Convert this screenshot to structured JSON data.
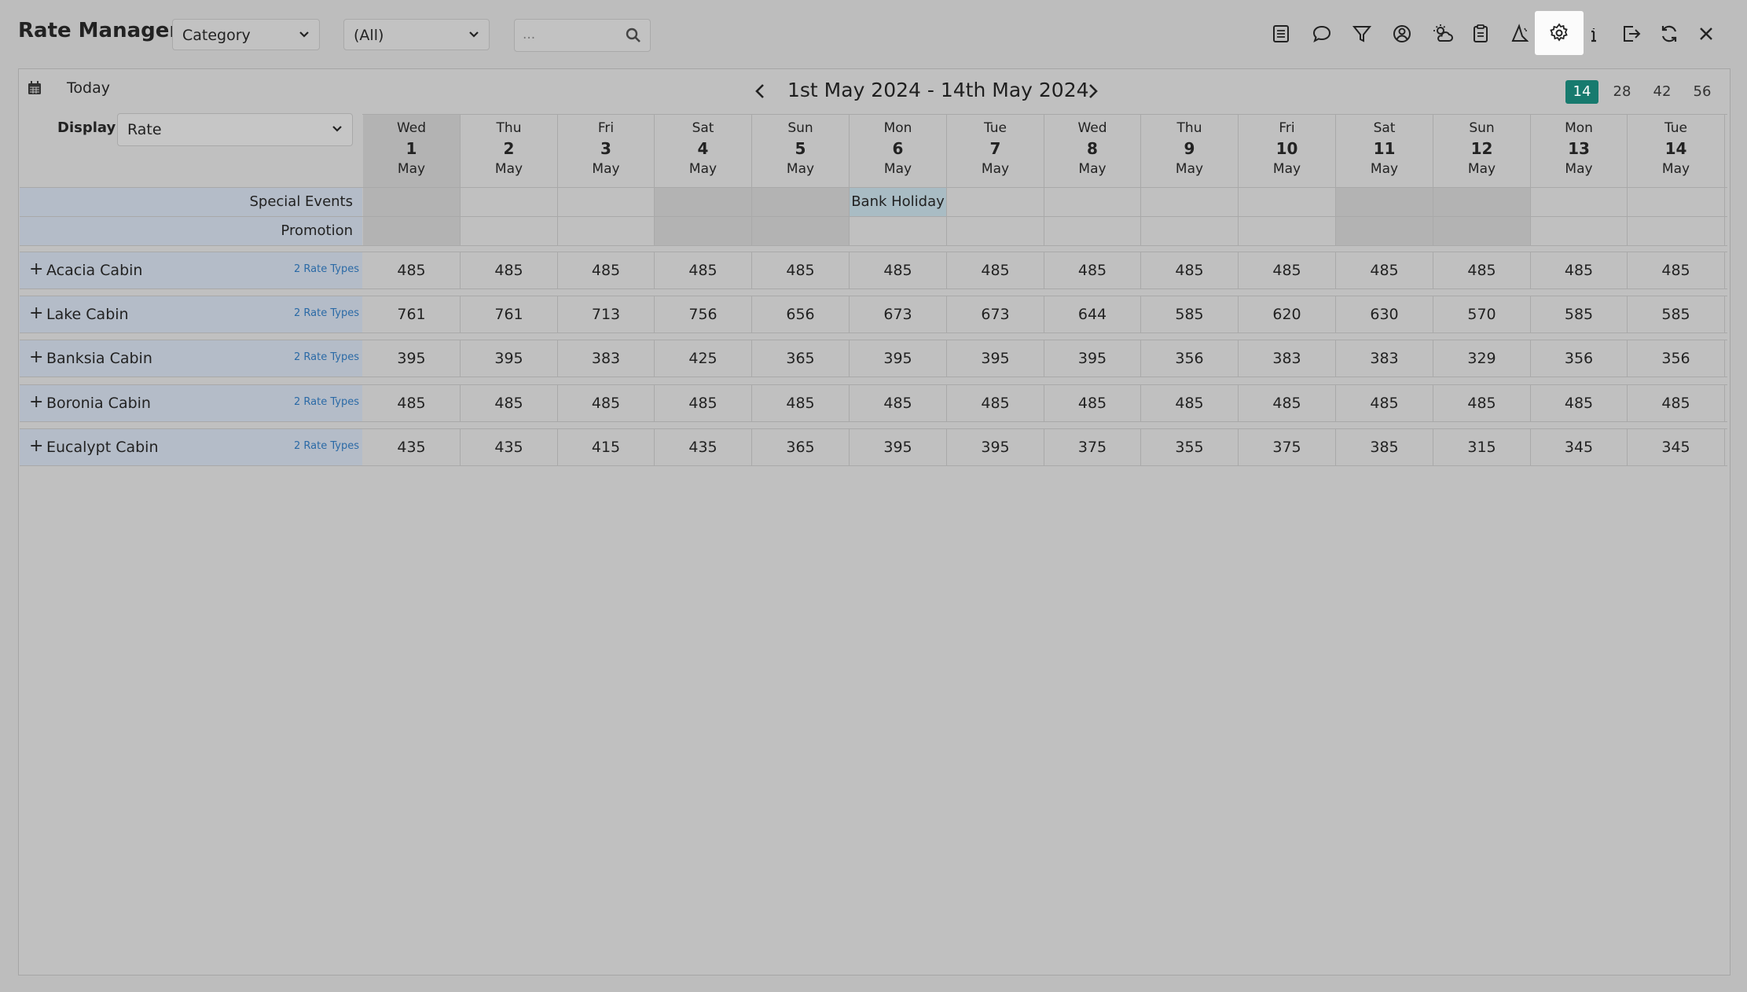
{
  "app": {
    "title": "Rate Manager"
  },
  "filters": {
    "group_by": "Category",
    "filter_value": "(All)",
    "search_placeholder": "..."
  },
  "toolbar": {
    "icons": [
      "report-icon",
      "comment-icon",
      "filter-icon",
      "user-icon",
      "weather-icon",
      "clipboard-icon",
      "wizard-icon",
      "gear-icon",
      "info-icon",
      "export-icon",
      "refresh-icon",
      "close-icon"
    ],
    "active": "gear-icon"
  },
  "calendar": {
    "today_label": "Today",
    "range_title": "1st May 2024 - 14th May 2024",
    "spans": [
      "14",
      "28",
      "42",
      "56"
    ],
    "active_span": "14",
    "display_label": "Display:",
    "display_value": "Rate",
    "days": [
      {
        "wd": "Wed",
        "dn": "1",
        "mo": "May"
      },
      {
        "wd": "Thu",
        "dn": "2",
        "mo": "May"
      },
      {
        "wd": "Fri",
        "dn": "3",
        "mo": "May"
      },
      {
        "wd": "Sat",
        "dn": "4",
        "mo": "May"
      },
      {
        "wd": "Sun",
        "dn": "5",
        "mo": "May"
      },
      {
        "wd": "Mon",
        "dn": "6",
        "mo": "May"
      },
      {
        "wd": "Tue",
        "dn": "7",
        "mo": "May"
      },
      {
        "wd": "Wed",
        "dn": "8",
        "mo": "May"
      },
      {
        "wd": "Thu",
        "dn": "9",
        "mo": "May"
      },
      {
        "wd": "Fri",
        "dn": "10",
        "mo": "May"
      },
      {
        "wd": "Sat",
        "dn": "11",
        "mo": "May"
      },
      {
        "wd": "Sun",
        "dn": "12",
        "mo": "May"
      },
      {
        "wd": "Mon",
        "dn": "13",
        "mo": "May"
      },
      {
        "wd": "Tue",
        "dn": "14",
        "mo": "May"
      }
    ],
    "special_events_label": "Special Events",
    "promotion_label": "Promotion",
    "event": {
      "day_index": 5,
      "label": "Bank Holiday"
    }
  },
  "categories": [
    {
      "name": "Acacia Cabin",
      "rate_types": "2 Rate Types",
      "rates": [
        "485",
        "485",
        "485",
        "485",
        "485",
        "485",
        "485",
        "485",
        "485",
        "485",
        "485",
        "485",
        "485",
        "485"
      ]
    },
    {
      "name": "Lake Cabin",
      "rate_types": "2 Rate Types",
      "rates": [
        "761",
        "761",
        "713",
        "756",
        "656",
        "673",
        "673",
        "644",
        "585",
        "620",
        "630",
        "570",
        "585",
        "585"
      ]
    },
    {
      "name": "Banksia Cabin",
      "rate_types": "2 Rate Types",
      "rates": [
        "395",
        "395",
        "383",
        "425",
        "365",
        "395",
        "395",
        "395",
        "356",
        "383",
        "383",
        "329",
        "356",
        "356"
      ]
    },
    {
      "name": "Boronia Cabin",
      "rate_types": "2 Rate Types",
      "rates": [
        "485",
        "485",
        "485",
        "485",
        "485",
        "485",
        "485",
        "485",
        "485",
        "485",
        "485",
        "485",
        "485",
        "485"
      ]
    },
    {
      "name": "Eucalypt Cabin",
      "rate_types": "2 Rate Types",
      "rates": [
        "435",
        "435",
        "415",
        "435",
        "365",
        "395",
        "395",
        "375",
        "355",
        "375",
        "385",
        "315",
        "345",
        "345"
      ]
    }
  ]
}
